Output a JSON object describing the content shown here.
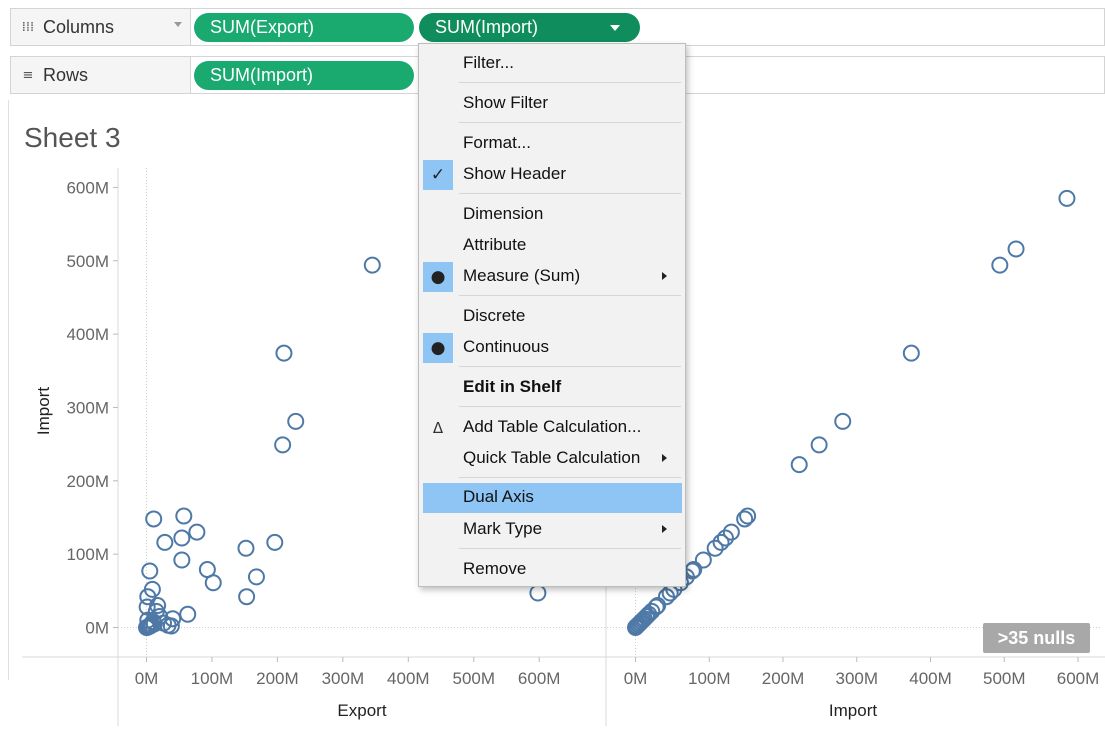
{
  "columns_shelf": {
    "label": "Columns",
    "icon": "columns-icon",
    "pills": [
      {
        "label": "SUM(Export)"
      },
      {
        "label": "SUM(Import)"
      }
    ]
  },
  "rows_shelf": {
    "label": "Rows",
    "icon": "rows-icon",
    "pills": [
      {
        "label": "SUM(Import)"
      }
    ]
  },
  "sheet": {
    "title": "Sheet 3",
    "nulls_badge": ">35 nulls"
  },
  "context_menu": {
    "items": {
      "filter": "Filter...",
      "show_filter": "Show Filter",
      "format": "Format...",
      "show_header": "Show Header",
      "dimension": "Dimension",
      "attribute": "Attribute",
      "measure": "Measure (Sum)",
      "discrete": "Discrete",
      "continuous": "Continuous",
      "edit_in_shelf": "Edit in Shelf",
      "add_table_calc": "Add Table Calculation...",
      "quick_table_calc": "Quick Table Calculation",
      "dual_axis": "Dual Axis",
      "mark_type": "Mark Type",
      "remove": "Remove"
    },
    "highlight_color": "#8ec5f4"
  },
  "colors": {
    "pill_green": "#1aaa70",
    "pill_active": "#0f8d5c",
    "mark_stroke": "#4e79a7"
  },
  "chart_data": [
    {
      "type": "scatter",
      "xlabel": "Export",
      "ylabel": "Import",
      "x_ticks": [
        "0M",
        "100M",
        "200M",
        "300M",
        "400M",
        "500M",
        "600M"
      ],
      "y_ticks": [
        "0M",
        "100M",
        "200M",
        "300M",
        "400M",
        "500M",
        "600M"
      ],
      "xlim": [
        -20,
        640
      ],
      "ylim": [
        -30,
        610
      ],
      "points": [
        [
          345,
          494
        ],
        [
          210,
          374
        ],
        [
          228,
          281
        ],
        [
          208,
          249
        ],
        [
          196,
          116
        ],
        [
          152,
          108
        ],
        [
          168,
          69
        ],
        [
          153,
          42
        ],
        [
          57,
          152
        ],
        [
          11,
          148
        ],
        [
          77,
          130
        ],
        [
          54,
          122
        ],
        [
          28,
          116
        ],
        [
          54,
          92
        ],
        [
          93,
          79
        ],
        [
          102,
          61
        ],
        [
          5,
          77
        ],
        [
          9,
          52
        ],
        [
          2,
          42
        ],
        [
          1,
          28
        ],
        [
          17,
          30
        ],
        [
          15,
          22
        ],
        [
          20,
          15
        ],
        [
          40,
          12
        ],
        [
          63,
          18
        ],
        [
          10,
          8
        ],
        [
          26,
          6
        ],
        [
          33,
          3
        ],
        [
          38,
          2
        ],
        [
          3,
          1
        ],
        [
          6,
          2
        ],
        [
          0,
          0
        ],
        [
          1,
          0
        ],
        [
          4,
          2
        ],
        [
          8,
          4
        ],
        [
          12,
          5
        ],
        [
          2,
          10
        ],
        [
          598,
          47
        ]
      ]
    },
    {
      "type": "scatter",
      "xlabel": "Import",
      "ylabel": "Import",
      "x_ticks": [
        "0M",
        "100M",
        "200M",
        "300M",
        "400M",
        "500M",
        "600M"
      ],
      "xlim": [
        -20,
        640
      ],
      "ylim": [
        -30,
        610
      ],
      "points": [
        [
          585,
          585
        ],
        [
          516,
          516
        ],
        [
          494,
          494
        ],
        [
          374,
          374
        ],
        [
          281,
          281
        ],
        [
          249,
          249
        ],
        [
          222,
          222
        ],
        [
          152,
          152
        ],
        [
          148,
          148
        ],
        [
          130,
          130
        ],
        [
          122,
          122
        ],
        [
          116,
          116
        ],
        [
          108,
          108
        ],
        [
          92,
          92
        ],
        [
          79,
          79
        ],
        [
          77,
          77
        ],
        [
          69,
          69
        ],
        [
          61,
          61
        ],
        [
          52,
          52
        ],
        [
          47,
          47
        ],
        [
          42,
          42
        ],
        [
          30,
          30
        ],
        [
          28,
          28
        ],
        [
          22,
          22
        ],
        [
          18,
          18
        ],
        [
          15,
          15
        ],
        [
          12,
          12
        ],
        [
          10,
          10
        ],
        [
          8,
          8
        ],
        [
          6,
          6
        ],
        [
          4,
          4
        ],
        [
          2,
          2
        ],
        [
          1,
          1
        ],
        [
          0,
          0
        ]
      ]
    }
  ]
}
